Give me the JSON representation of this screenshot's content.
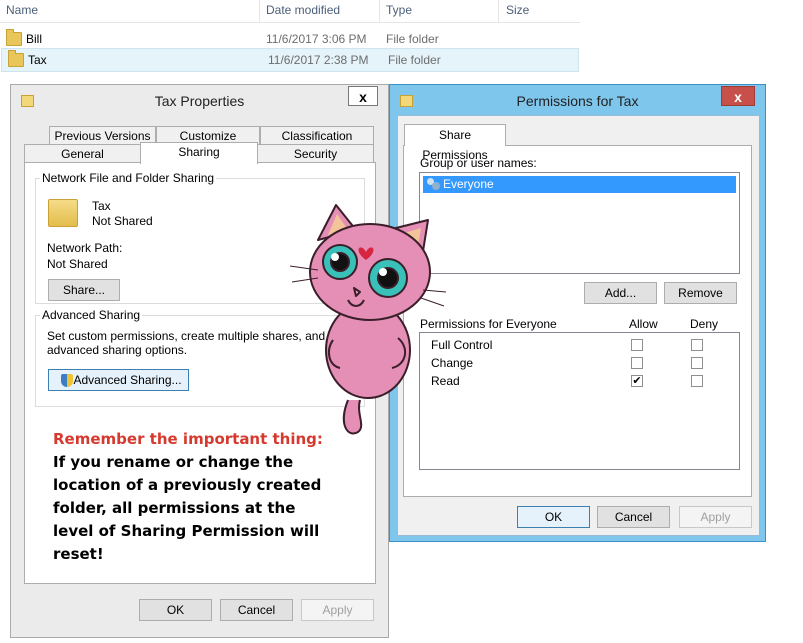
{
  "explorer": {
    "columns": {
      "name": "Name",
      "date": "Date modified",
      "type": "Type",
      "size": "Size"
    },
    "rows": [
      {
        "name": "Bill",
        "date": "11/6/2017 3:06 PM",
        "type": "File folder"
      },
      {
        "name": "Tax",
        "date": "11/6/2017 2:38 PM",
        "type": "File folder"
      }
    ]
  },
  "tax_properties": {
    "title": "Tax Properties",
    "close": "x",
    "tabs_back": [
      "Previous Versions",
      "Customize",
      "Classification"
    ],
    "tabs_front": [
      "General",
      "Sharing",
      "Security"
    ],
    "active_tab": "Sharing",
    "network_group": {
      "label": "Network File and Folder Sharing",
      "folder_name": "Tax",
      "status": "Not Shared",
      "path_label": "Network Path:",
      "path_value": "Not Shared",
      "share_button": "Share..."
    },
    "advanced_group": {
      "label": "Advanced Sharing",
      "description_line1": "Set custom permissions, create multiple shares, and set other",
      "description_line2": "advanced sharing options.",
      "button": "Advanced Sharing..."
    },
    "buttons": {
      "ok": "OK",
      "cancel": "Cancel",
      "apply": "Apply"
    }
  },
  "note": {
    "title": "Remember the important thing:",
    "lines": [
      "If you rename or change the",
      "location of a previously created",
      "folder, all permissions at the",
      "level of Sharing Permission will",
      "reset!"
    ]
  },
  "permissions": {
    "title": "Permissions for Tax",
    "close": "x",
    "tab": "Share Permissions",
    "group_label": "Group or user names:",
    "users": [
      "Everyone"
    ],
    "add_button": "Add...",
    "remove_button": "Remove",
    "perms_label": "Permissions for Everyone",
    "allow_header": "Allow",
    "deny_header": "Deny",
    "rows": [
      {
        "name": "Full Control",
        "allow": false,
        "deny": false
      },
      {
        "name": "Change",
        "allow": false,
        "deny": false
      },
      {
        "name": "Read",
        "allow": true,
        "deny": false
      }
    ],
    "buttons": {
      "ok": "OK",
      "cancel": "Cancel",
      "apply": "Apply"
    }
  },
  "colors": {
    "accent_selection": "#3399ff",
    "perms_frame": "#7fc6ec",
    "note_title": "#d63a2f",
    "close_red": "#c7504a"
  }
}
